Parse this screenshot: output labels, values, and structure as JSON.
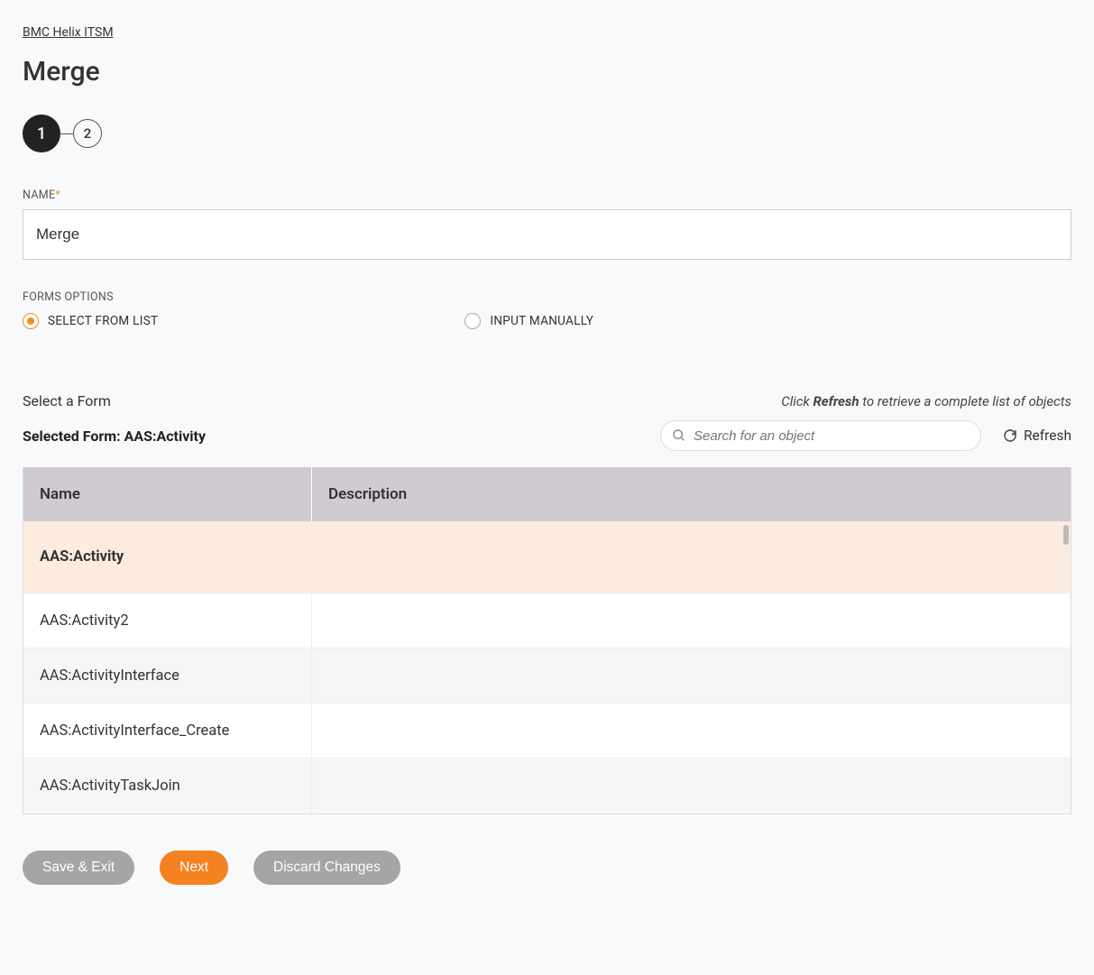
{
  "breadcrumb": "BMC Helix ITSM",
  "page_title": "Merge",
  "stepper": {
    "step1": "1",
    "step2": "2"
  },
  "name_field": {
    "label": "NAME",
    "value": "Merge"
  },
  "forms_options": {
    "label": "FORMS OPTIONS",
    "option_select": "SELECT FROM LIST",
    "option_manual": "INPUT MANUALLY"
  },
  "select_section": {
    "title": "Select a Form",
    "hint_prefix": "Click ",
    "hint_bold": "Refresh",
    "hint_suffix": " to retrieve a complete list of objects",
    "selected_prefix": "Selected Form: ",
    "selected_value": "AAS:Activity",
    "search_placeholder": "Search for an object",
    "refresh_label": "Refresh"
  },
  "table": {
    "col_name": "Name",
    "col_desc": "Description",
    "rows": [
      {
        "name": "AAS:Activity",
        "desc": ""
      },
      {
        "name": "AAS:Activity2",
        "desc": ""
      },
      {
        "name": "AAS:ActivityInterface",
        "desc": ""
      },
      {
        "name": "AAS:ActivityInterface_Create",
        "desc": ""
      },
      {
        "name": "AAS:ActivityTaskJoin",
        "desc": ""
      }
    ]
  },
  "buttons": {
    "save_exit": "Save & Exit",
    "next": "Next",
    "discard": "Discard Changes"
  }
}
